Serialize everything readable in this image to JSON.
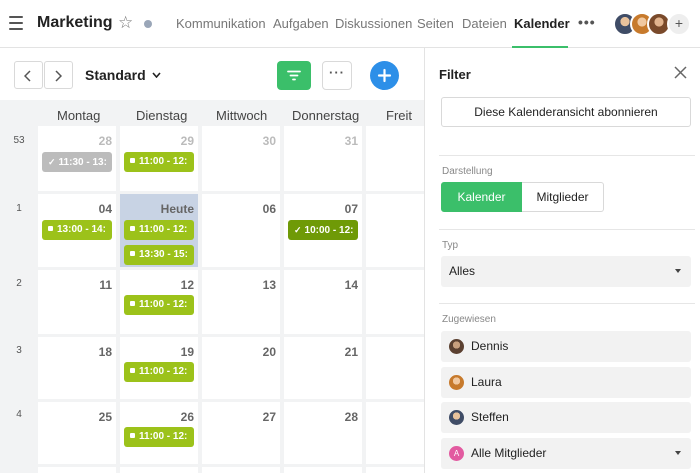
{
  "header": {
    "title": "Marketing",
    "nav": [
      {
        "label": "Kommunikation",
        "active": false
      },
      {
        "label": "Aufgaben",
        "active": false
      },
      {
        "label": "Diskussionen",
        "active": false
      },
      {
        "label": "Seiten",
        "active": false
      },
      {
        "label": "Dateien",
        "active": false
      },
      {
        "label": "Kalender",
        "active": true
      }
    ],
    "more": "•••",
    "add_member": "+"
  },
  "toolbar": {
    "view": "Standard",
    "more": "···"
  },
  "calendar": {
    "days": [
      "Montag",
      "Dienstag",
      "Mittwoch",
      "Donnerstag",
      "Freit"
    ],
    "weeks": [
      {
        "week": "53",
        "dates": [
          "28",
          "29",
          "30",
          "31",
          ""
        ]
      },
      {
        "week": "1",
        "dates": [
          "04",
          "Heute",
          "06",
          "07",
          ""
        ]
      },
      {
        "week": "2",
        "dates": [
          "11",
          "12",
          "13",
          "14",
          ""
        ]
      },
      {
        "week": "3",
        "dates": [
          "18",
          "19",
          "20",
          "21",
          ""
        ]
      },
      {
        "week": "4",
        "dates": [
          "25",
          "26",
          "27",
          "28",
          ""
        ]
      }
    ],
    "events": [
      {
        "time": "11:30 - 13:",
        "style": "gray",
        "marker": "check"
      },
      {
        "time": "11:00 - 12:",
        "style": "green",
        "marker": "square"
      },
      {
        "time": "13:00 - 14:",
        "style": "green",
        "marker": "square"
      },
      {
        "time": "11:00 - 12:",
        "style": "green",
        "marker": "square"
      },
      {
        "time": "13:30 - 15:",
        "style": "green",
        "marker": "square"
      },
      {
        "time": "10:00 - 12:",
        "style": "dark",
        "marker": "check"
      },
      {
        "time": "11:00 - 12:",
        "style": "green",
        "marker": "square"
      },
      {
        "time": "11:00 - 12:",
        "style": "green",
        "marker": "square"
      },
      {
        "time": "11:00 - 12:",
        "style": "green",
        "marker": "square"
      }
    ]
  },
  "filter": {
    "title": "Filter",
    "subscribe": "Diese Kalenderansicht abonnieren",
    "display_label": "Darstellung",
    "display_options": [
      "Kalender",
      "Mitglieder"
    ],
    "type_label": "Typ",
    "type_value": "Alles",
    "assigned_label": "Zugewiesen",
    "members": [
      "Dennis",
      "Laura",
      "Steffen",
      "Alle Mitglieder"
    ],
    "all_members_initial": "A"
  },
  "colors": {
    "accent_green": "#3bbf6a",
    "event_green": "#9cc21a",
    "event_dark_green": "#6f9a07",
    "event_gray": "#bcbcbc",
    "today_bg": "#c8d3e4",
    "add_blue": "#2d8fe8",
    "all_members_pink": "#e25aa0"
  }
}
